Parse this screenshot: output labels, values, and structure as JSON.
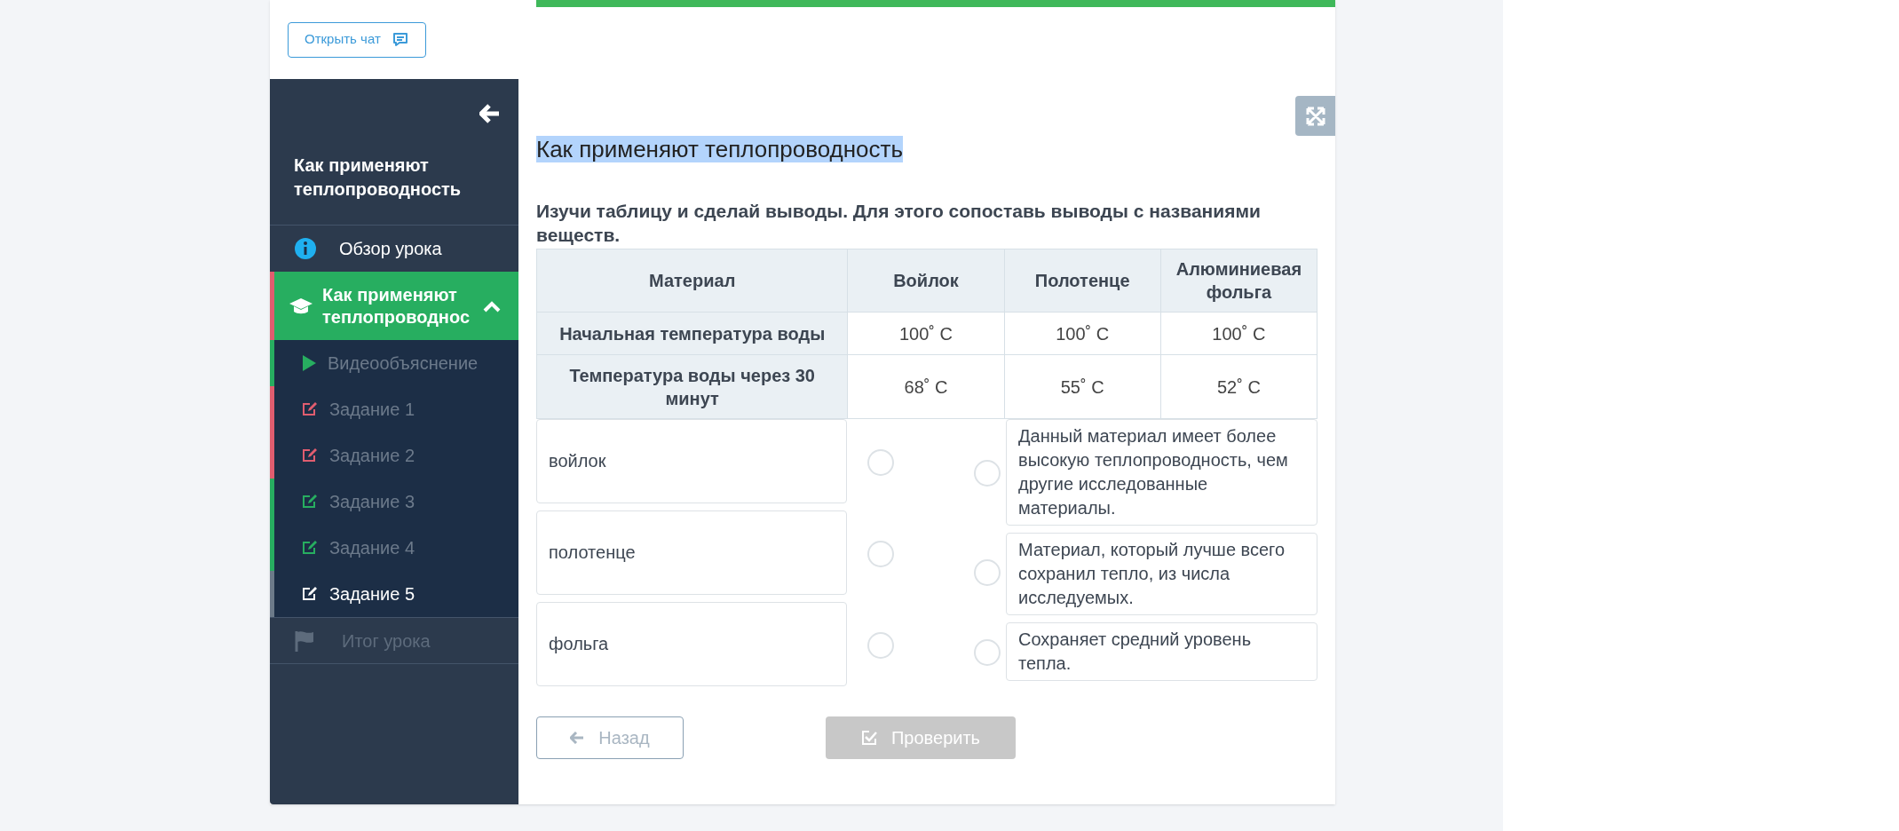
{
  "chat_button": {
    "label": "Открыть чат"
  },
  "progress": {
    "level": 1
  },
  "sidebar": {
    "title": "Как применяют теплопроводность",
    "items": [
      {
        "kind": "overview",
        "label": "Обзор урока",
        "disabled": false
      },
      {
        "kind": "section",
        "label": "Как применяют теплопроводнос",
        "expanded": true,
        "children": [
          {
            "kind": "video",
            "label": "Видеообъяснение",
            "color": "#27ae60",
            "selected": false
          },
          {
            "kind": "task",
            "label": "Задание 1",
            "color": "#e05d6f",
            "selected": false
          },
          {
            "kind": "task",
            "label": "Задание 2",
            "color": "#e05d6f",
            "selected": false
          },
          {
            "kind": "task",
            "label": "Задание 3",
            "color": "#27ae60",
            "selected": false
          },
          {
            "kind": "task",
            "label": "Задание 4",
            "color": "#27ae60",
            "selected": false
          },
          {
            "kind": "task",
            "label": "Задание 5",
            "color": "#6c7a89",
            "selected": true
          }
        ]
      },
      {
        "kind": "summary",
        "label": "Итог урока",
        "disabled": true
      }
    ]
  },
  "lesson": {
    "title": "Как применяют теплопроводность",
    "instruction": "Изучи таблицу и сделай выводы. Для этого сопоставь выводы с названиями веществ.",
    "table": {
      "columns": [
        "Материал",
        "Войлок",
        "Полотенце",
        "Алюминиевая фольга"
      ],
      "rows": [
        [
          "Начальная температура воды",
          "100˚ С",
          "100˚ С",
          "100˚ С"
        ],
        [
          "Температура воды через 30 минут",
          "68˚ С",
          "55˚ С",
          "52˚ С"
        ]
      ]
    },
    "matching": {
      "left": [
        "войлок",
        "полотенце",
        "фольга"
      ],
      "right": [
        "Данный материал имеет более высокую теплопроводность, чем другие исследованные материалы.",
        "Материал, который лучше всего сохранил тепло, из числа исследуемых.",
        "Сохраняет средний уровень тепла."
      ]
    },
    "buttons": [
      {
        "kind": "back",
        "label": "Назад",
        "disabled": false
      },
      {
        "kind": "check",
        "label": "Проверить",
        "disabled": true
      }
    ]
  }
}
